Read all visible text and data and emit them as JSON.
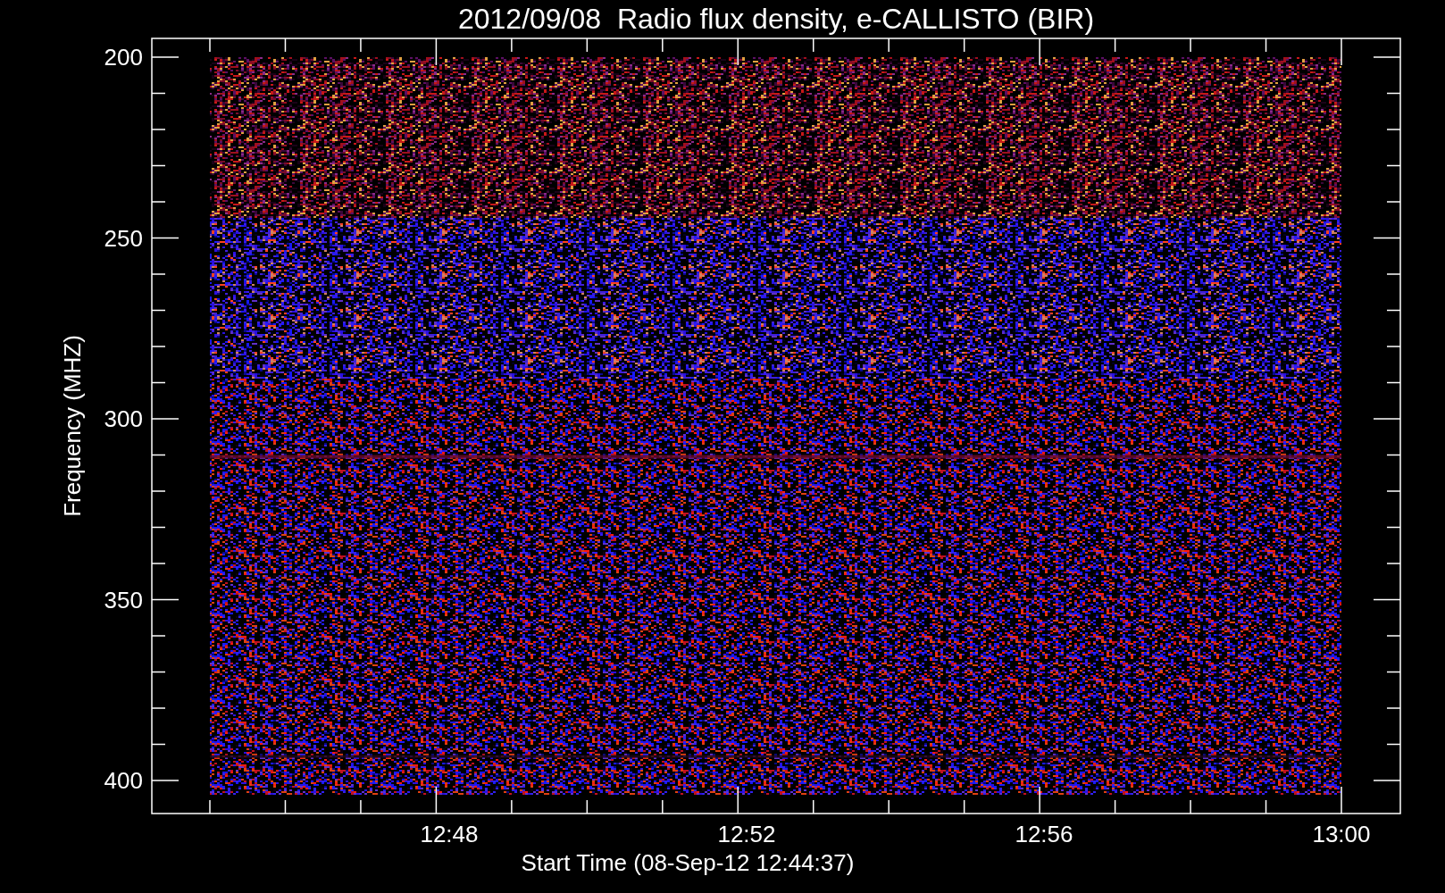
{
  "title": "2012/09/08  Radio flux density, e-CALLISTO (BIR)",
  "y_axis": {
    "label": "Frequency (MHZ)",
    "ticks": [
      "200",
      "250",
      "300",
      "350",
      "400"
    ]
  },
  "x_axis": {
    "label": "Start Time (08-Sep-12 12:44:37)",
    "ticks": [
      "12:48",
      "12:52",
      "12:56",
      "13:00"
    ]
  }
}
